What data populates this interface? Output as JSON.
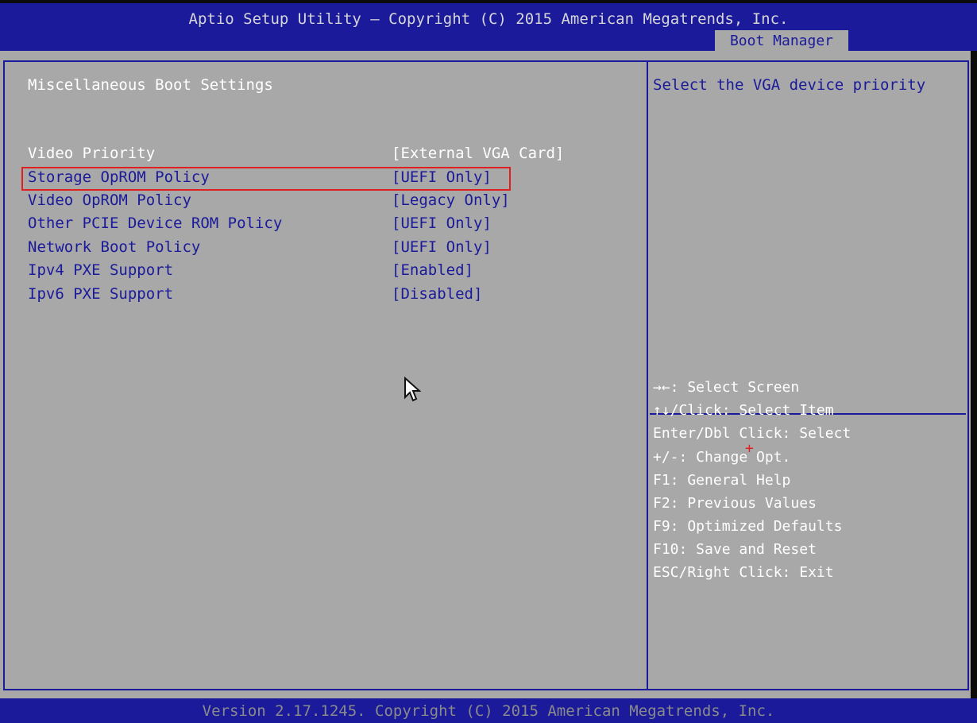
{
  "header": {
    "title": "Aptio Setup Utility – Copyright (C) 2015 American Megatrends, Inc.",
    "active_tab": "Boot Manager"
  },
  "main": {
    "section_title": "Miscellaneous Boot Settings",
    "settings": [
      {
        "label": "Video Priority",
        "value": "[External VGA Card]"
      },
      {
        "label": "Storage OpROM Policy",
        "value": "[UEFI Only]"
      },
      {
        "label": "Video OpROM Policy",
        "value": "[Legacy Only]"
      },
      {
        "label": "Other PCIE Device ROM Policy",
        "value": "[UEFI Only]"
      },
      {
        "label": "Network Boot Policy",
        "value": "[UEFI Only]"
      },
      {
        "label": "Ipv4 PXE Support",
        "value": "[Enabled]"
      },
      {
        "label": "Ipv6 PXE Support",
        "value": "[Disabled]"
      }
    ]
  },
  "help": {
    "description": "Select the VGA device priority",
    "keys": [
      "→←: Select Screen",
      "↑↓/Click: Select Item",
      "Enter/Dbl Click: Select",
      "+/-: Change Opt.",
      "F1: General Help",
      "F2: Previous Values",
      "F9: Optimized Defaults",
      "F10: Save and Reset",
      "ESC/Right Click: Exit"
    ]
  },
  "footer": {
    "version": "Version 2.17.1245. Copyright (C) 2015 American Megatrends, Inc."
  },
  "colors": {
    "header_blue": "#1a1a9b",
    "panel_gray": "#a8a8a8",
    "highlight_red": "#e02020",
    "text_white": "#ffffff"
  },
  "icons": {
    "mouse_pointer": "mouse-pointer-icon",
    "red_cross": "red-cross-icon"
  }
}
